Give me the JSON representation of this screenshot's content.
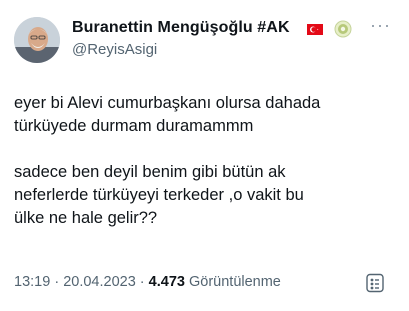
{
  "author": {
    "display_name": "Buranettin Mengüşoğlu #AK",
    "handle": "@ReyisAsigi",
    "name_emoji": [
      "turkish-flag-icon",
      "badge-icon"
    ]
  },
  "tweet": {
    "paragraph_1_line_1": "eyer bi Alevi cumurbaşkanı olursa dahada",
    "paragraph_1_line_2": "türküyede durmam duramammm",
    "paragraph_2_line_1": "sadece ben deyil benim gibi bütün ak",
    "paragraph_2_line_2": "neferlerde türküyeyi terkeder ,o vakit bu",
    "paragraph_2_line_3": "ülke ne hale gelir??"
  },
  "meta": {
    "time": "13:19",
    "separator": " · ",
    "date": "20.04.2023",
    "views_count": "4.473",
    "views_label": "Görüntülenme"
  },
  "colors": {
    "text": "#0f1419",
    "secondary": "#536471",
    "flag_red": "#e30a17"
  }
}
